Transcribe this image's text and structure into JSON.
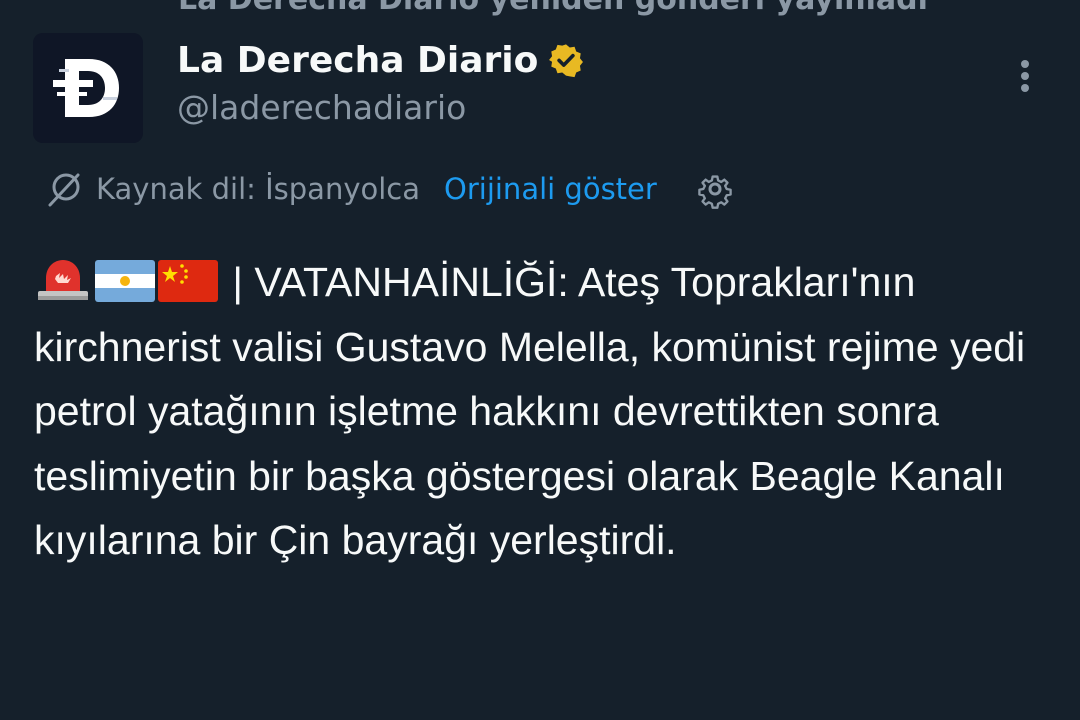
{
  "repost": {
    "text": "La Derecha Diario yeniden gönderi yayınladı"
  },
  "author": {
    "display_name": "La Derecha Diario",
    "handle": "@laderechadiario",
    "verified": true,
    "verified_color": "#e8b923",
    "avatar_icon": "letter-d-logo-icon"
  },
  "translation": {
    "source_label": "Kaynak dil: İspanyolca",
    "show_original_label": "Orijinali göster",
    "link_color": "#1d9bf0"
  },
  "tweet": {
    "emojis": [
      "rotating-light-icon",
      "argentina-flag-icon",
      "china-flag-icon"
    ],
    "text": " | VATANHAİNLİĞİ: Ateş Toprakları'nın kirchnerist valisi Gustavo Melella, komünist rejime yedi petrol yatağının işletme hakkını devrettikten sonra teslimiyetin bir başka göstergesi olarak Beagle Kanalı kıyılarına bir Çin bayrağı yerleştirdi."
  },
  "theme": {
    "background": "#15202b",
    "text_primary": "#f7f9f9",
    "text_secondary": "#8b98a5"
  }
}
